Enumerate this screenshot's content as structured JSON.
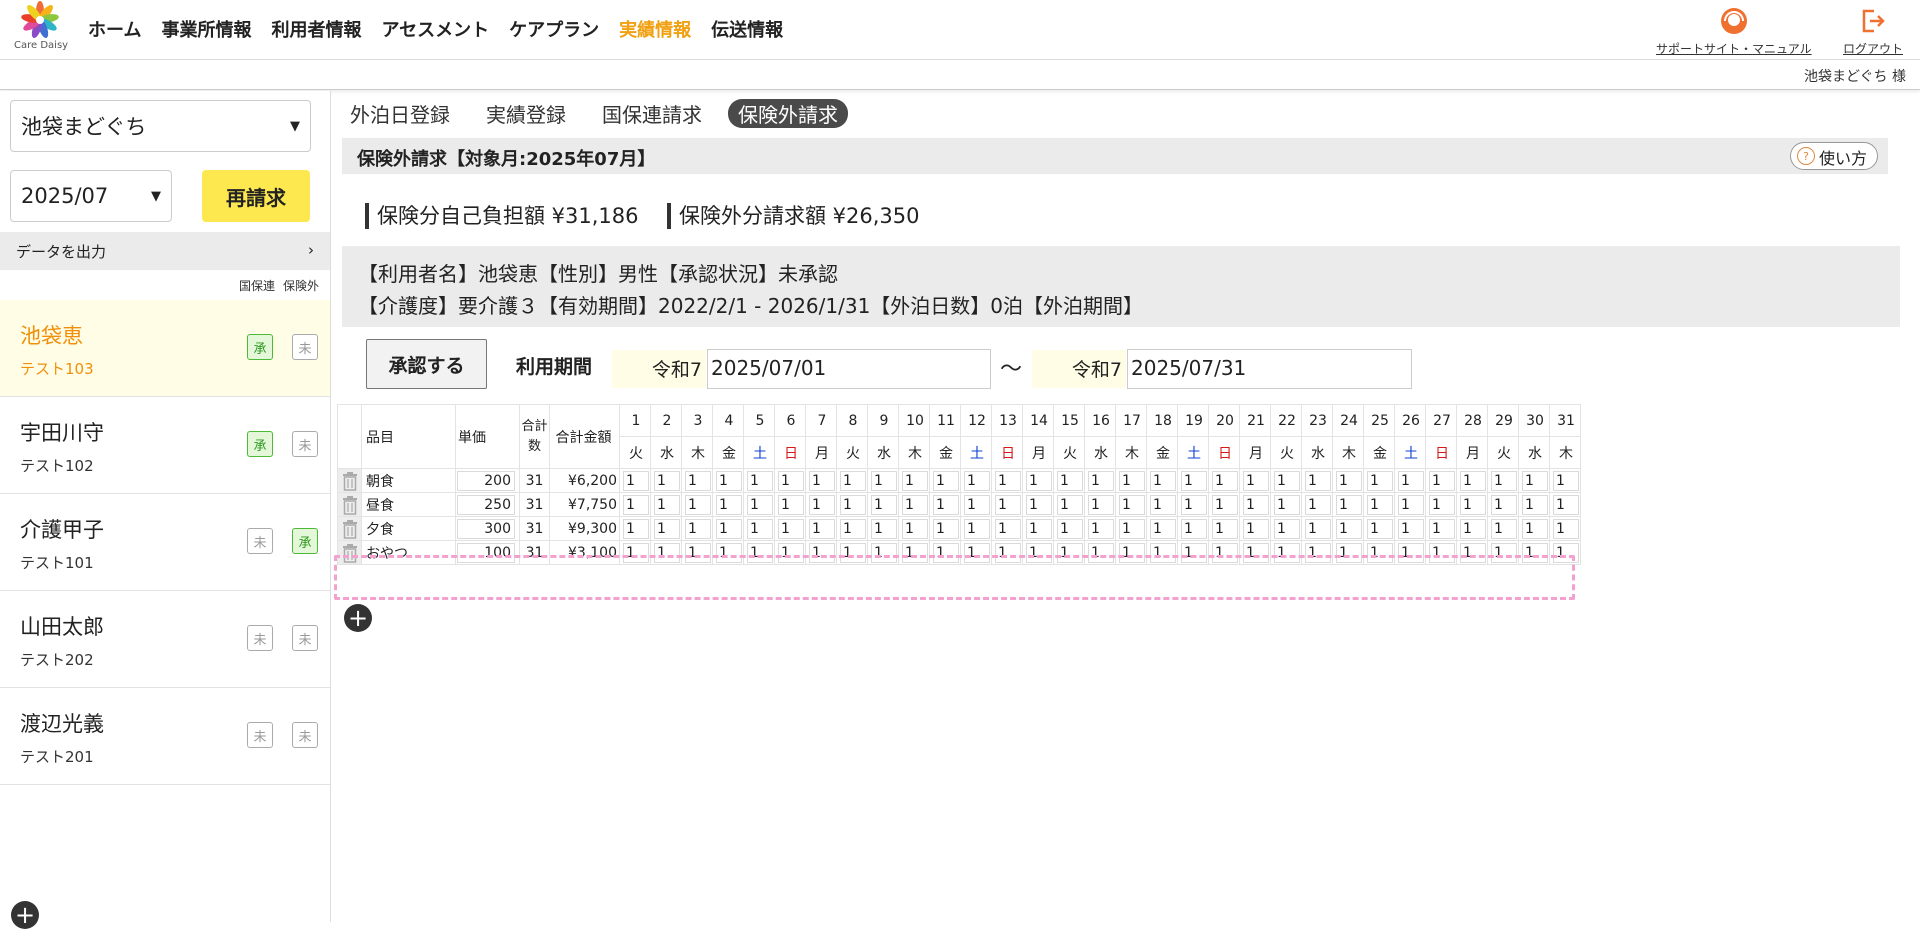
{
  "header": {
    "logo_text": "Care Daisy",
    "nav": [
      "ホーム",
      "事業所情報",
      "利用者情報",
      "アセスメント",
      "ケアプラン",
      "実績情報",
      "伝送情報"
    ],
    "active_nav": "実績情報",
    "support_label": "サポートサイト・マニュアル",
    "logout_label": "ログアウト",
    "user_label": "池袋まどぐち 様"
  },
  "sidebar": {
    "office_select": "池袋まどぐち",
    "month_select": "2025/07",
    "reclaim_button": "再請求",
    "export_label": "データを出力",
    "col_kokuhoren": "国保連",
    "col_hokengai": "保険外",
    "users": [
      {
        "name": "池袋恵",
        "code": "テスト103",
        "kokuhoren": "承",
        "hokengai": "未",
        "kokuhoren_ok": true,
        "hokengai_ok": false,
        "selected": true
      },
      {
        "name": "宇田川守",
        "code": "テスト102",
        "kokuhoren": "承",
        "hokengai": "未",
        "kokuhoren_ok": true,
        "hokengai_ok": false,
        "selected": false
      },
      {
        "name": "介護甲子",
        "code": "テスト101",
        "kokuhoren": "未",
        "hokengai": "承",
        "kokuhoren_ok": false,
        "hokengai_ok": true,
        "selected": false
      },
      {
        "name": "山田太郎",
        "code": "テスト202",
        "kokuhoren": "未",
        "hokengai": "未",
        "kokuhoren_ok": false,
        "hokengai_ok": false,
        "selected": false
      },
      {
        "name": "渡辺光義",
        "code": "テスト201",
        "kokuhoren": "未",
        "hokengai": "未",
        "kokuhoren_ok": false,
        "hokengai_ok": false,
        "selected": false
      }
    ]
  },
  "tabs": [
    "外泊日登録",
    "実績登録",
    "国保連請求",
    "保険外請求"
  ],
  "active_tab": "保険外請求",
  "title": "保険外請求【対象月:2025年07月】",
  "howto_label": "使い方",
  "summary": {
    "insured": "保険分自己負担額 ¥31,186",
    "uninsured": "保険外分請求額 ¥26,350"
  },
  "info": {
    "line1": "【利用者名】池袋恵【性別】男性【承認状況】未承認",
    "line2": "【介護度】要介護３【有効期間】2022/2/1 - 2026/1/31【外泊日数】0泊【外泊期間】"
  },
  "approve_button": "承認する",
  "period_label": "利用期間",
  "period": {
    "era_from": "令和7",
    "from": "2025/07/01",
    "tilde": "〜",
    "era_to": "令和7",
    "to": "2025/07/31"
  },
  "grid": {
    "h_item": "品目",
    "h_price": "単価",
    "h_count": "合計数",
    "h_amount": "合計金額",
    "days": [
      "1",
      "2",
      "3",
      "4",
      "5",
      "6",
      "7",
      "8",
      "9",
      "10",
      "11",
      "12",
      "13",
      "14",
      "15",
      "16",
      "17",
      "18",
      "19",
      "20",
      "21",
      "22",
      "23",
      "24",
      "25",
      "26",
      "27",
      "28",
      "29",
      "30",
      "31"
    ],
    "weekdays": [
      "火",
      "水",
      "木",
      "金",
      "土",
      "日",
      "月",
      "火",
      "水",
      "木",
      "金",
      "土",
      "日",
      "月",
      "火",
      "水",
      "木",
      "金",
      "土",
      "日",
      "月",
      "火",
      "水",
      "木",
      "金",
      "土",
      "日",
      "月",
      "火",
      "水",
      "木"
    ],
    "rows": [
      {
        "name": "朝食",
        "price": "200",
        "count": "31",
        "amount": "¥6,200",
        "value": "1"
      },
      {
        "name": "昼食",
        "price": "250",
        "count": "31",
        "amount": "¥7,750",
        "value": "1"
      },
      {
        "name": "夕食",
        "price": "300",
        "count": "31",
        "amount": "¥9,300",
        "value": "1"
      },
      {
        "name": "おやつ",
        "price": "100",
        "count": "31",
        "amount": "¥3,100",
        "value": "1"
      }
    ]
  },
  "colors": {
    "accent": "#f0a010",
    "approve_green": "#4cba37",
    "button_yellow": "#fde84f",
    "highlight": "#f3a2d0",
    "saturday": "#1040d0",
    "sunday": "#d81818"
  },
  "icons": [
    "daisy-logo-icon",
    "support-headset-icon",
    "logout-icon",
    "chevron-down-icon",
    "chevron-right-icon",
    "trash-icon",
    "plus-icon",
    "question-icon"
  ]
}
